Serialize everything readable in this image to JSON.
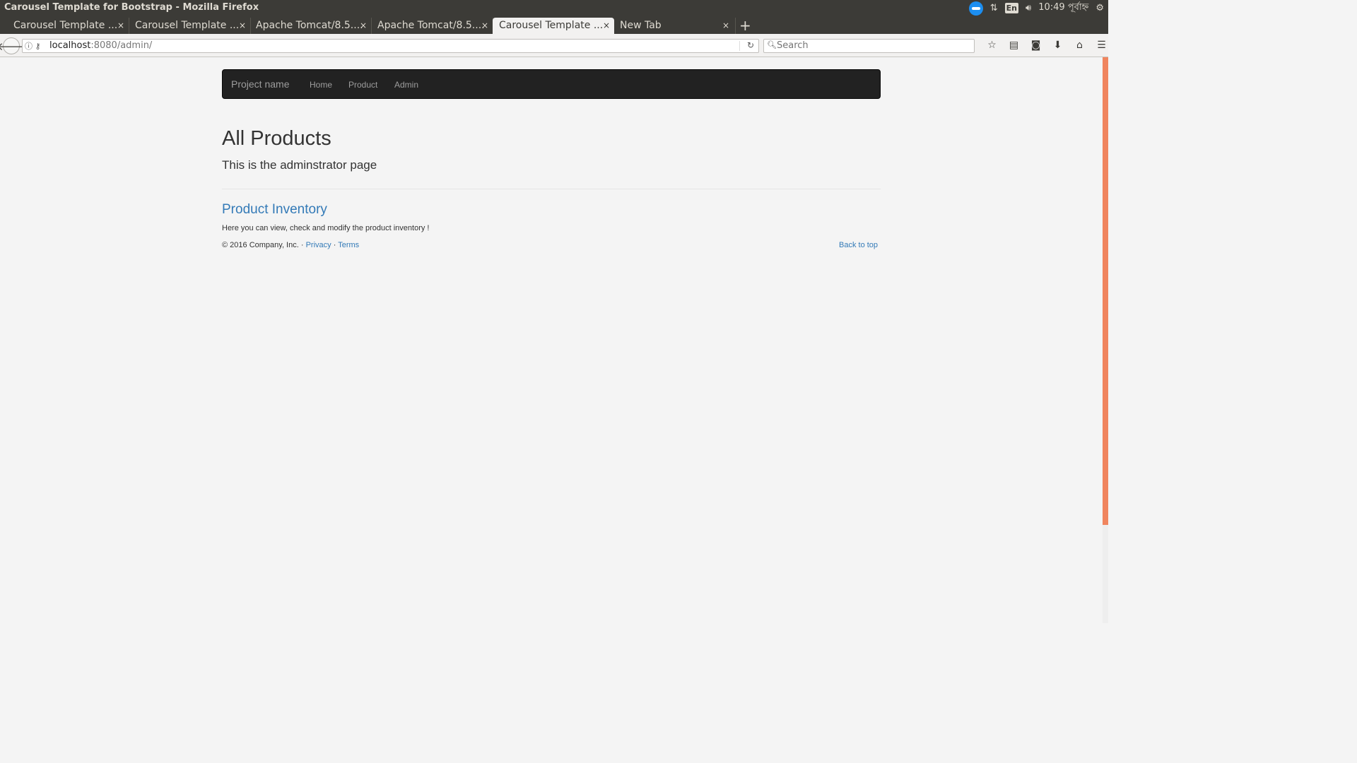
{
  "os": {
    "window_title": "Carousel Template for Bootstrap - Mozilla Firefox",
    "clock": "10:49 পূর্বাহ্ন",
    "keyboard_layout": "En"
  },
  "tabs": [
    {
      "label": "Carousel Template ...",
      "active": false
    },
    {
      "label": "Carousel Template ...",
      "active": false
    },
    {
      "label": "Apache Tomcat/8.5....",
      "active": false
    },
    {
      "label": "Apache Tomcat/8.5....",
      "active": false
    },
    {
      "label": "Carousel Template ...",
      "active": true
    },
    {
      "label": "New Tab",
      "active": false
    }
  ],
  "tab_close_glyph": "×",
  "new_tab_glyph": "+",
  "urlbar": {
    "host": "localhost",
    "rest": ":8080/admin/"
  },
  "search": {
    "placeholder": "Search"
  },
  "site": {
    "brand": "Project name",
    "nav": [
      "Home",
      "Product",
      "Admin"
    ],
    "heading": "All Products",
    "subheading": "This is the adminstrator page",
    "inventory_link": "Product Inventory",
    "inventory_text": "Here you can view, check and modify the product inventory !",
    "footer_copy": "© 2016 Company, Inc. ·",
    "footer_privacy": "Privacy",
    "footer_dot": "·",
    "footer_terms": "Terms",
    "back_to_top": "Back to top"
  },
  "colors": {
    "link": "#337ab7",
    "navbar_bg": "#222222",
    "scroll_thumb": "#f0855e",
    "ubuntu_panel": "#3c3b37"
  }
}
